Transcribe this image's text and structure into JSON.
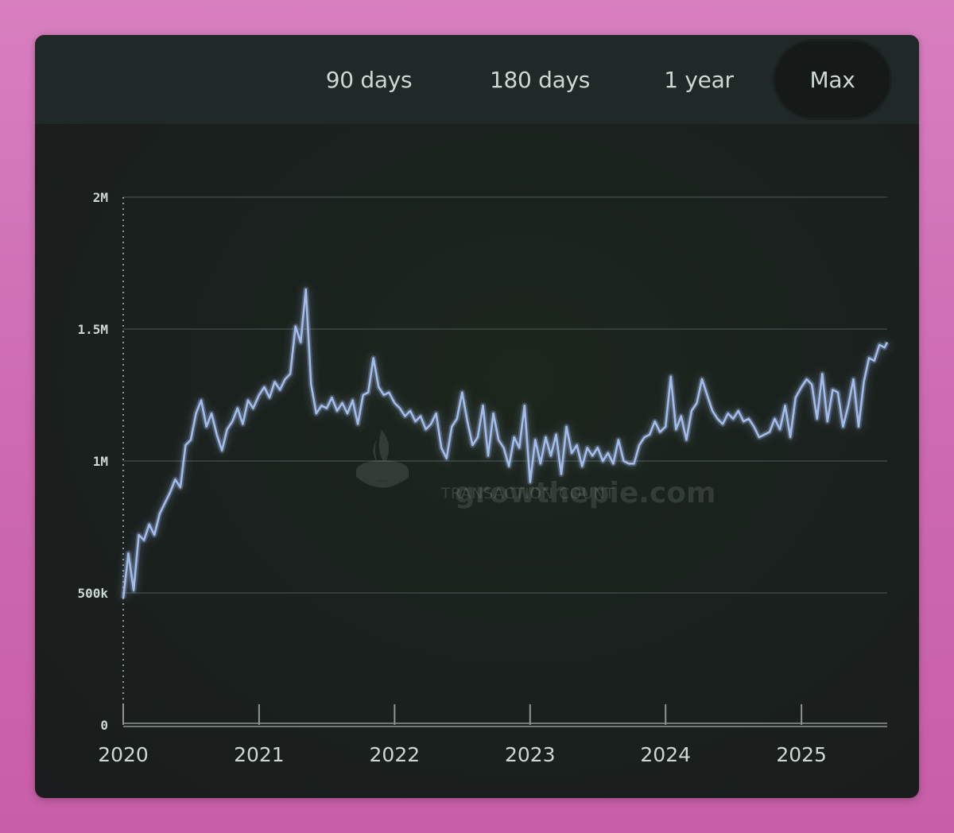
{
  "tabs": [
    {
      "label": "90 days",
      "active": false
    },
    {
      "label": "180 days",
      "active": false
    },
    {
      "label": "1 year",
      "active": false
    },
    {
      "label": "Max",
      "active": true
    }
  ],
  "watermark": {
    "brand": "growthepie.com",
    "caption": "TRANSACTION COUNT"
  },
  "colors": {
    "line": "#a3bcec",
    "grid": "#3d4745",
    "text": "#cdd8d3",
    "active_tab": "#151918"
  },
  "chart_data": {
    "type": "line",
    "x_type": "date",
    "series": [
      {
        "points": [
          [
            "2020-01-01",
            480000
          ],
          [
            "2020-01-15",
            650000
          ],
          [
            "2020-01-29",
            510000
          ],
          [
            "2020-02-12",
            720000
          ],
          [
            "2020-02-26",
            700000
          ],
          [
            "2020-03-11",
            760000
          ],
          [
            "2020-03-25",
            720000
          ],
          [
            "2020-04-08",
            800000
          ],
          [
            "2020-04-22",
            840000
          ],
          [
            "2020-05-06",
            880000
          ],
          [
            "2020-05-20",
            930000
          ],
          [
            "2020-06-03",
            900000
          ],
          [
            "2020-06-17",
            1060000
          ],
          [
            "2020-07-01",
            1080000
          ],
          [
            "2020-07-15",
            1180000
          ],
          [
            "2020-07-29",
            1230000
          ],
          [
            "2020-08-12",
            1130000
          ],
          [
            "2020-08-26",
            1180000
          ],
          [
            "2020-09-09",
            1100000
          ],
          [
            "2020-09-23",
            1040000
          ],
          [
            "2020-10-07",
            1120000
          ],
          [
            "2020-10-21",
            1150000
          ],
          [
            "2020-11-04",
            1200000
          ],
          [
            "2020-11-18",
            1140000
          ],
          [
            "2020-12-02",
            1230000
          ],
          [
            "2020-12-16",
            1200000
          ],
          [
            "2021-01-01",
            1250000
          ],
          [
            "2021-01-15",
            1280000
          ],
          [
            "2021-01-29",
            1240000
          ],
          [
            "2021-02-12",
            1300000
          ],
          [
            "2021-02-26",
            1270000
          ],
          [
            "2021-03-12",
            1310000
          ],
          [
            "2021-03-26",
            1330000
          ],
          [
            "2021-04-09",
            1510000
          ],
          [
            "2021-04-23",
            1450000
          ],
          [
            "2021-05-07",
            1650000
          ],
          [
            "2021-05-21",
            1290000
          ],
          [
            "2021-06-04",
            1180000
          ],
          [
            "2021-06-18",
            1210000
          ],
          [
            "2021-07-02",
            1200000
          ],
          [
            "2021-07-16",
            1240000
          ],
          [
            "2021-07-30",
            1190000
          ],
          [
            "2021-08-13",
            1220000
          ],
          [
            "2021-08-27",
            1180000
          ],
          [
            "2021-09-10",
            1230000
          ],
          [
            "2021-09-24",
            1140000
          ],
          [
            "2021-10-08",
            1250000
          ],
          [
            "2021-10-22",
            1260000
          ],
          [
            "2021-11-05",
            1390000
          ],
          [
            "2021-11-19",
            1280000
          ],
          [
            "2021-12-03",
            1250000
          ],
          [
            "2021-12-17",
            1260000
          ],
          [
            "2022-01-01",
            1220000
          ],
          [
            "2022-01-15",
            1200000
          ],
          [
            "2022-01-29",
            1170000
          ],
          [
            "2022-02-12",
            1190000
          ],
          [
            "2022-02-26",
            1150000
          ],
          [
            "2022-03-12",
            1170000
          ],
          [
            "2022-03-26",
            1120000
          ],
          [
            "2022-04-09",
            1140000
          ],
          [
            "2022-04-23",
            1180000
          ],
          [
            "2022-05-07",
            1050000
          ],
          [
            "2022-05-21",
            1010000
          ],
          [
            "2022-06-04",
            1130000
          ],
          [
            "2022-06-18",
            1160000
          ],
          [
            "2022-07-02",
            1260000
          ],
          [
            "2022-07-16",
            1150000
          ],
          [
            "2022-07-30",
            1060000
          ],
          [
            "2022-08-13",
            1090000
          ],
          [
            "2022-08-27",
            1210000
          ],
          [
            "2022-09-10",
            1020000
          ],
          [
            "2022-09-24",
            1180000
          ],
          [
            "2022-10-08",
            1080000
          ],
          [
            "2022-10-22",
            1050000
          ],
          [
            "2022-11-05",
            980000
          ],
          [
            "2022-11-19",
            1090000
          ],
          [
            "2022-12-03",
            1050000
          ],
          [
            "2022-12-17",
            1210000
          ],
          [
            "2023-01-01",
            920000
          ],
          [
            "2023-01-15",
            1080000
          ],
          [
            "2023-01-29",
            990000
          ],
          [
            "2023-02-12",
            1090000
          ],
          [
            "2023-02-26",
            1020000
          ],
          [
            "2023-03-12",
            1100000
          ],
          [
            "2023-03-26",
            950000
          ],
          [
            "2023-04-09",
            1130000
          ],
          [
            "2023-04-23",
            1030000
          ],
          [
            "2023-05-07",
            1060000
          ],
          [
            "2023-05-21",
            980000
          ],
          [
            "2023-06-04",
            1050000
          ],
          [
            "2023-06-18",
            1020000
          ],
          [
            "2023-07-02",
            1050000
          ],
          [
            "2023-07-16",
            1000000
          ],
          [
            "2023-07-30",
            1030000
          ],
          [
            "2023-08-13",
            990000
          ],
          [
            "2023-08-27",
            1080000
          ],
          [
            "2023-09-10",
            1000000
          ],
          [
            "2023-09-24",
            990000
          ],
          [
            "2023-10-08",
            990000
          ],
          [
            "2023-10-22",
            1060000
          ],
          [
            "2023-11-05",
            1090000
          ],
          [
            "2023-11-19",
            1100000
          ],
          [
            "2023-12-03",
            1150000
          ],
          [
            "2023-12-17",
            1110000
          ],
          [
            "2024-01-01",
            1130000
          ],
          [
            "2024-01-15",
            1320000
          ],
          [
            "2024-01-29",
            1120000
          ],
          [
            "2024-02-12",
            1170000
          ],
          [
            "2024-02-26",
            1080000
          ],
          [
            "2024-03-11",
            1190000
          ],
          [
            "2024-03-25",
            1220000
          ],
          [
            "2024-04-08",
            1310000
          ],
          [
            "2024-04-22",
            1250000
          ],
          [
            "2024-05-06",
            1190000
          ],
          [
            "2024-05-20",
            1160000
          ],
          [
            "2024-06-03",
            1140000
          ],
          [
            "2024-06-17",
            1180000
          ],
          [
            "2024-07-01",
            1160000
          ],
          [
            "2024-07-15",
            1190000
          ],
          [
            "2024-07-29",
            1150000
          ],
          [
            "2024-08-12",
            1160000
          ],
          [
            "2024-08-26",
            1130000
          ],
          [
            "2024-09-09",
            1090000
          ],
          [
            "2024-09-23",
            1100000
          ],
          [
            "2024-10-07",
            1110000
          ],
          [
            "2024-10-21",
            1160000
          ],
          [
            "2024-11-04",
            1120000
          ],
          [
            "2024-11-18",
            1210000
          ],
          [
            "2024-12-02",
            1090000
          ],
          [
            "2024-12-16",
            1240000
          ],
          [
            "2025-01-01",
            1280000
          ],
          [
            "2025-01-15",
            1310000
          ],
          [
            "2025-01-29",
            1290000
          ],
          [
            "2025-02-12",
            1160000
          ],
          [
            "2025-02-26",
            1330000
          ],
          [
            "2025-03-12",
            1150000
          ],
          [
            "2025-03-26",
            1270000
          ],
          [
            "2025-04-09",
            1260000
          ],
          [
            "2025-04-23",
            1130000
          ],
          [
            "2025-05-07",
            1210000
          ],
          [
            "2025-05-21",
            1310000
          ],
          [
            "2025-06-04",
            1130000
          ],
          [
            "2025-06-18",
            1300000
          ],
          [
            "2025-07-02",
            1390000
          ],
          [
            "2025-07-16",
            1380000
          ],
          [
            "2025-07-30",
            1440000
          ],
          [
            "2025-08-13",
            1430000
          ],
          [
            "2025-08-20",
            1450000
          ]
        ]
      }
    ],
    "y_ticks": [
      0,
      500000,
      1000000,
      1500000,
      2000000
    ],
    "y_tick_labels": [
      "0",
      "500k",
      "1M",
      "1.5M",
      "2M"
    ],
    "ylim": [
      0,
      2000000
    ],
    "x_ticks": [
      "2020-01-01",
      "2021-01-01",
      "2022-01-01",
      "2023-01-01",
      "2024-01-01",
      "2025-01-01"
    ],
    "x_tick_labels": [
      "2020",
      "2021",
      "2022",
      "2023",
      "2024",
      "2025"
    ],
    "xlim": [
      "2020-01-01",
      "2025-08-20"
    ],
    "grid": true,
    "legend": "none"
  }
}
